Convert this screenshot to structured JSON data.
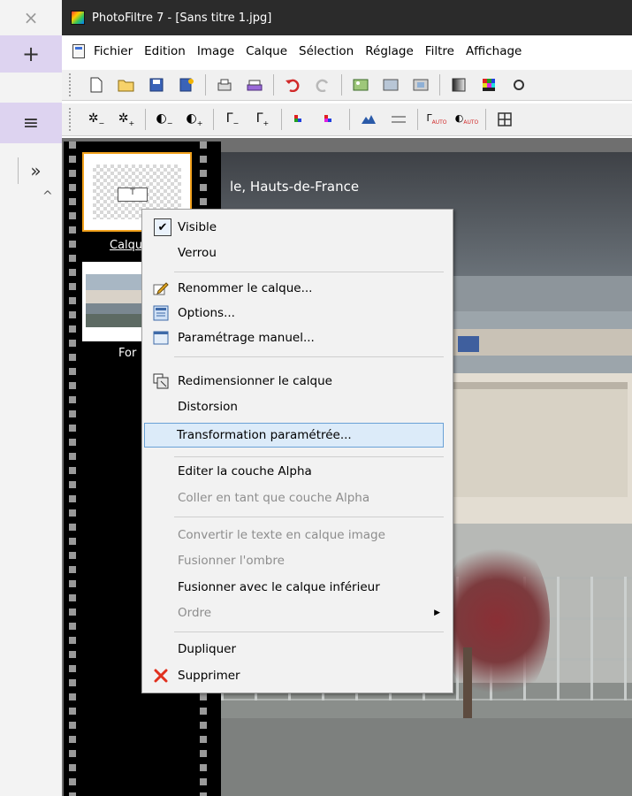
{
  "left_panel": {
    "close_glyph": "×",
    "add_glyph": "+",
    "menu_glyph": "≡",
    "expand_glyph": "»",
    "collapse_glyph": "^"
  },
  "window": {
    "title": "PhotoFiltre 7 - [Sans titre 1.jpg]"
  },
  "menubar": {
    "items": [
      "Fichier",
      "Edition",
      "Image",
      "Calque",
      "Sélection",
      "Réglage",
      "Filtre",
      "Affichage"
    ]
  },
  "toolbar1": {
    "tools": [
      "new-file-icon",
      "open-folder-icon",
      "save-icon",
      "save-as-icon",
      "print-icon",
      "scan-icon",
      "undo-icon",
      "redo-icon",
      "image-icon-1",
      "image-icon-2",
      "image-icon-3",
      "gradient-icon",
      "color-grid-icon",
      "settings-icon"
    ]
  },
  "toolbar2": {
    "tools": [
      "brightness-down-icon",
      "brightness-up-icon",
      "contrast-down-icon",
      "contrast-up-icon",
      "gamma-down-icon",
      "gamma-up-icon",
      "saturation-down-icon",
      "saturation-up-icon",
      "mountain-icon",
      "levels-icon",
      "auto-gamma-icon",
      "auto-contrast-icon",
      "grid-icon"
    ]
  },
  "layers": {
    "layer1_label": "Calqu",
    "layer1_mark": "T",
    "layer2_label": "For"
  },
  "canvas": {
    "caption": "le, Hauts-de-France"
  },
  "context_menu": {
    "items": [
      {
        "label": "Visible",
        "checked": true
      },
      {
        "label": "Verrou"
      },
      {
        "label": "Renommer le calque..."
      },
      {
        "label": "Options..."
      },
      {
        "label": "Paramétrage manuel..."
      },
      {
        "label": "Redimensionner le calque"
      },
      {
        "label": "Distorsion"
      },
      {
        "label": "Transformation paramétrée...",
        "highlighted": true
      },
      {
        "label": "Editer la couche Alpha"
      },
      {
        "label": "Coller en tant que couche Alpha",
        "disabled": true
      },
      {
        "label": "Convertir le texte en calque image",
        "disabled": true
      },
      {
        "label": "Fusionner l'ombre",
        "disabled": true
      },
      {
        "label": "Fusionner avec le calque inférieur"
      },
      {
        "label": "Ordre",
        "disabled": true,
        "submenu": true
      },
      {
        "label": "Dupliquer"
      },
      {
        "label": "Supprimer"
      }
    ]
  }
}
